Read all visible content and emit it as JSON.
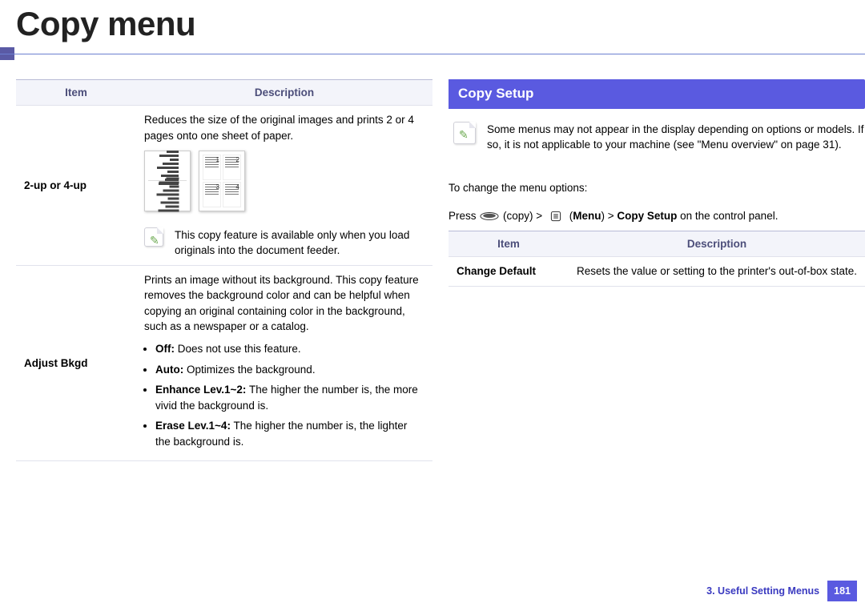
{
  "pageTitle": "Copy menu",
  "leftTable": {
    "headers": {
      "item": "Item",
      "description": "Description"
    },
    "rows": {
      "nup": {
        "item": "2-up or 4-up",
        "desc_intro": "Reduces the size of the original images and prints 2 or 4 pages onto one sheet of paper.",
        "note": "This copy feature is available only when you load originals into the document feeder."
      },
      "adjustBkgd": {
        "item": "Adjust Bkgd",
        "desc_intro": "Prints an image without its background. This copy feature removes the background color and can be helpful when copying an original containing color in the background, such as a newspaper or a catalog.",
        "options": {
          "off": {
            "label": "Off:",
            "text": " Does not use this feature."
          },
          "auto": {
            "label": "Auto:",
            "text": " Optimizes the background."
          },
          "enhance": {
            "label": "Enhance Lev.1~2:",
            "text": " The higher the number is, the more vivid the background is."
          },
          "erase": {
            "label": "Erase Lev.1~4:",
            "text": " The higher the number is, the lighter the background is."
          }
        }
      }
    }
  },
  "right": {
    "heading": "Copy Setup",
    "topNote": "Some menus may not appear in the display depending on options or models. If so, it is not applicable to your machine (see \"Menu overview\" on page 31).",
    "changeIntro": "To change the menu options:",
    "press": {
      "p1": "Press",
      "copyWord": " (copy) > ",
      "menuClose": "Menu",
      "afterMenu": ") > ",
      "copySetup": "Copy Setup",
      "tail": " on the control panel."
    },
    "table": {
      "headers": {
        "item": "Item",
        "description": "Description"
      },
      "row": {
        "item": "Change Default",
        "desc": "Resets the value or setting to the printer's out-of-box state."
      }
    }
  },
  "footer": {
    "section": "3.  Useful Setting Menus",
    "page": "181"
  }
}
